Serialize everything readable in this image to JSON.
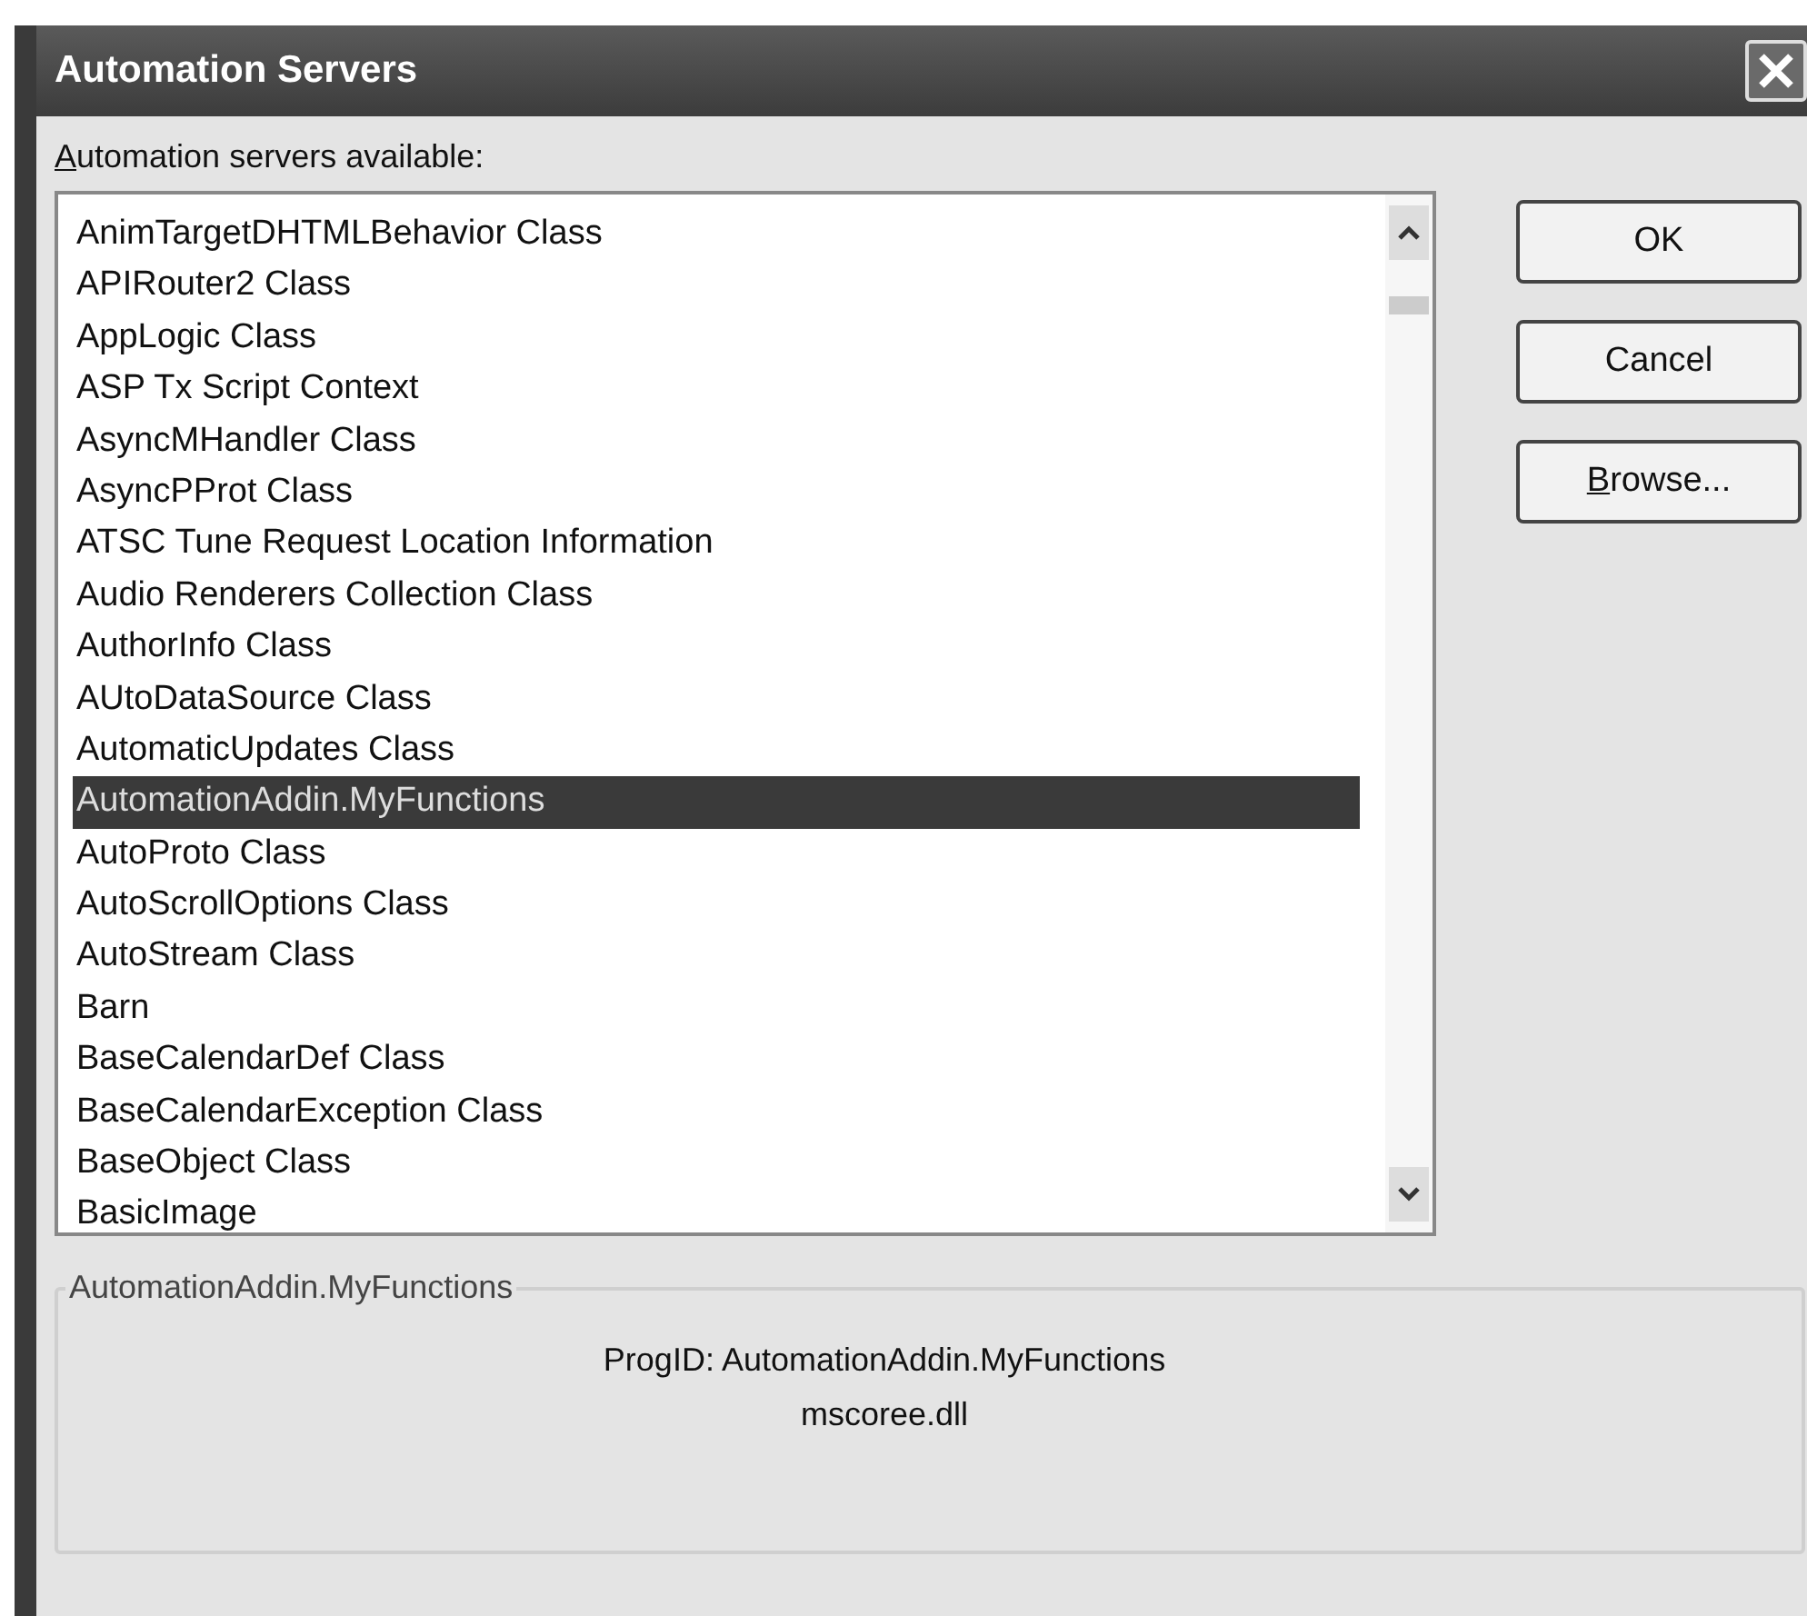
{
  "window": {
    "title": "Automation Servers"
  },
  "list_label": {
    "text": "Automation servers available:",
    "access_key_underlined": true
  },
  "servers": [
    {
      "name": "AnimTargetDHTMLBehavior Class",
      "selected": false
    },
    {
      "name": "APIRouter2 Class",
      "selected": false
    },
    {
      "name": "AppLogic Class",
      "selected": false
    },
    {
      "name": "ASP Tx Script Context",
      "selected": false
    },
    {
      "name": "AsyncMHandler Class",
      "selected": false
    },
    {
      "name": "AsyncPProt Class",
      "selected": false
    },
    {
      "name": "ATSC Tune Request Location Information",
      "selected": false
    },
    {
      "name": "Audio Renderers Collection Class",
      "selected": false
    },
    {
      "name": "AuthorInfo Class",
      "selected": false
    },
    {
      "name": "AUtoDataSource Class",
      "selected": false
    },
    {
      "name": "AutomaticUpdates Class",
      "selected": false
    },
    {
      "name": "AutomationAddin.MyFunctions",
      "selected": true
    },
    {
      "name": "AutoProto Class",
      "selected": false
    },
    {
      "name": "AutoScrollOptions Class",
      "selected": false
    },
    {
      "name": "AutoStream Class",
      "selected": false
    },
    {
      "name": "Barn",
      "selected": false
    },
    {
      "name": "BaseCalendarDef Class",
      "selected": false
    },
    {
      "name": "BaseCalendarException Class",
      "selected": false
    },
    {
      "name": "BaseObject Class",
      "selected": false
    },
    {
      "name": "BasicImage",
      "selected": false
    }
  ],
  "buttons": [
    {
      "label": "OK",
      "access_key_underlined": false
    },
    {
      "label": "Cancel",
      "access_key_underlined": false
    },
    {
      "label": "Browse...",
      "access_key_underlined": true
    }
  ],
  "details": {
    "legend": "AutomationAddin.MyFunctions",
    "lines": [
      "ProgID: AutomationAddin.MyFunctions",
      "mscoree.dll"
    ]
  }
}
